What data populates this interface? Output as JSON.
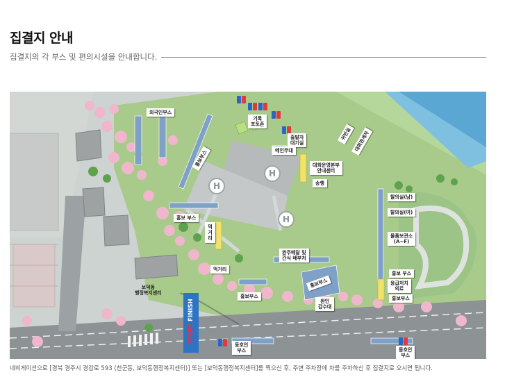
{
  "page": {
    "title": "집결지 안내",
    "subtitle": "집결지의 각 부스 및 편의시설을 안내합니다.",
    "footer": "네비게이션으로 [경북 경주시 경감로 593 (천군동, 보덕동행정복지센터)] 또는 [보덕동행정복지센터]를 찍으신 후, 주변 주차장에 차를 주차하신 후 집결지로 오시면 됩니다."
  },
  "map": {
    "start_finish": {
      "start": "START",
      "finish": "FINISH"
    },
    "helipad_symbol": "H",
    "labels": {
      "foreign_booth": "외국인부스",
      "promo_booth_diag": "홍보부스",
      "record_photo": "기록\n포토존",
      "participant_wait": "출발자\n대기실",
      "main_stage": "메인무대",
      "association_info": "대회운영본부\n안내센터",
      "broadcast": "송행",
      "storage": "귀빈실",
      "vip_room": "대회관계자",
      "changing_m": "탈의실(남)",
      "changing_f": "탈의실(여)",
      "goods_storage": "물품보관소\n(A~F)",
      "promo_booth_right": "홍보 부스",
      "first_aid": "응급처치\n의료",
      "promo_booth_right2": "홍보부스",
      "promo_booth_left": "홍보 부스",
      "food_street": "먹거리",
      "food_street2": "먹거리",
      "souvenir": "완주메달 및\n간식 배부처",
      "promo_booth_mid": "홍보부스",
      "promo_booth_center": "홍보부스",
      "finisher": "완인\n감수대",
      "bodeok_center": "보덕동\n행정복지센터",
      "bus_left": "동호인\n부스",
      "bus_right": "동호인\n부스"
    }
  }
}
